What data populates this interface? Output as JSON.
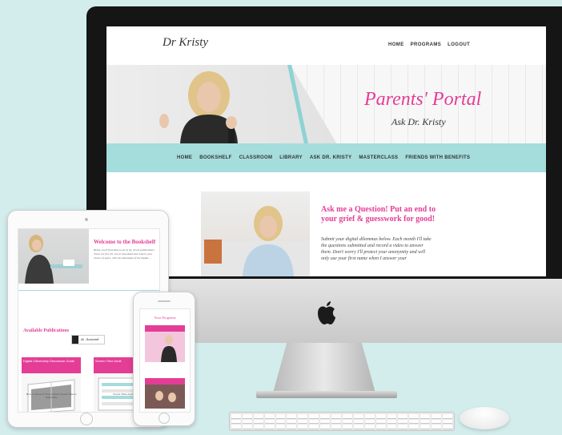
{
  "desktop": {
    "logo": "Dr Kristy",
    "top_nav": [
      "HOME",
      "PROGRAMS",
      "LOGOUT"
    ],
    "hero": {
      "title": "Parents' Portal",
      "subtitle": "Ask Dr. Kristy"
    },
    "main_nav": [
      "HOME",
      "BOOKSHELF",
      "CLASSROOM",
      "LIBRARY",
      "ASK DR. KRISTY",
      "MASTERCLASS",
      "FRIENDS WITH BENEFITS"
    ],
    "question": {
      "heading": "Ask me a Question! Put an end to your grief & guesswork for good!",
      "body": "Submit your digital dilemmas below. Each month I'll take the questions submitted and record a video to answer them. Don't worry I'll protect your anonymity and will only use your first name when I answer your"
    }
  },
  "tablet": {
    "welcome_title": "Welcome to the Bookshelf",
    "welcome_text": "Below you'll find links to all of my recent publications. These are free for you to download and read in your choice of spare, with the advantage of the digital ...",
    "available_heading": "Available Publications",
    "badge_label": "All - Bookshelf",
    "publications": [
      {
        "label": "Digital Citizenship Discussion Guide",
        "caption": "How to Know if Your Child's Screen Time is Unhealthy"
      },
      {
        "label": "Screen Time Audit",
        "caption": "Screen Time Audit"
      }
    ]
  },
  "phone": {
    "title": "Your Programs"
  },
  "colors": {
    "accent_pink": "#e43d96",
    "accent_teal": "#a5dcdc",
    "background": "#d3ecec"
  }
}
